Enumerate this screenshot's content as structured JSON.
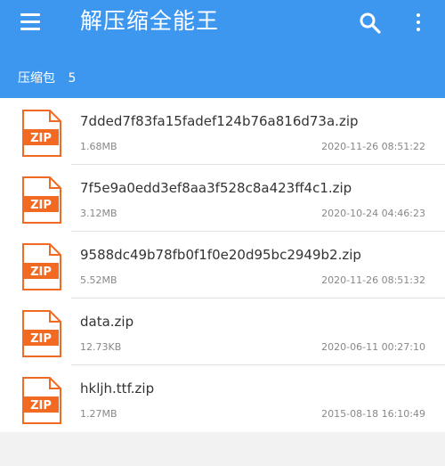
{
  "app": {
    "title": "解压缩全能王",
    "accent_color": "#3d97ef",
    "menu_icon": "hamburger-menu-icon",
    "search_icon": "search-icon",
    "more_icon": "more-vertical-icon"
  },
  "section": {
    "label": "压缩包",
    "count": "5"
  },
  "files": [
    {
      "name": "7dded7f83fa15fadef124b76a816d73a.zip",
      "size": "1.68MB",
      "date": "2020-11-26 08:51:22",
      "icon_label": "ZIP"
    },
    {
      "name": "7f5e9a0edd3ef8aa3f528c8a423ff4c1.zip",
      "size": "3.12MB",
      "date": "2020-10-24 04:46:23",
      "icon_label": "ZIP"
    },
    {
      "name": "9588dc49b78fb0f1f0e20d95bc2949b2.zip",
      "size": "5.52MB",
      "date": "2020-11-26 08:51:32",
      "icon_label": "ZIP"
    },
    {
      "name": "data.zip",
      "size": "12.73KB",
      "date": "2020-06-11 00:27:10",
      "icon_label": "ZIP"
    },
    {
      "name": "hkljh.ttf.zip",
      "size": "1.27MB",
      "date": "2015-08-18 16:10:49",
      "icon_label": "ZIP"
    }
  ]
}
